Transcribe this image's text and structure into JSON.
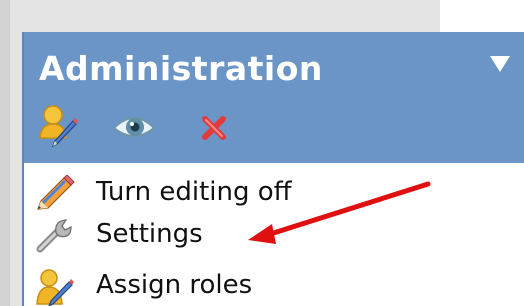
{
  "block": {
    "title": "Administration",
    "header_icons": [
      {
        "name": "assign-roles-icon"
      },
      {
        "name": "eye-icon"
      },
      {
        "name": "delete-icon"
      }
    ],
    "collapse_icon": "triangle-down-icon",
    "items": [
      {
        "label": "Turn editing off",
        "icon": "pencil-icon"
      },
      {
        "label": "Settings",
        "icon": "wrench-icon"
      },
      {
        "label": "Assign roles",
        "icon": "assign-roles-icon"
      }
    ]
  },
  "annotation": {
    "arrow_color": "#e01010",
    "target": "Settings"
  },
  "colors": {
    "header_bg": "#6a95c6",
    "header_text": "#ffffff",
    "block_border": "#5d86b7",
    "page_column": "#e4e4e4"
  }
}
